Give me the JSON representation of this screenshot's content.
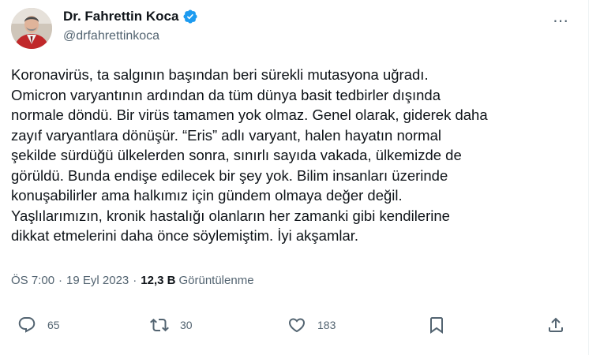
{
  "author": {
    "name": "Dr. Fahrettin Koca",
    "handle": "@drfahrettinkoca",
    "verified": true
  },
  "more_icon": "⋯",
  "tweet": {
    "lines": [
      "Koronavirüs, ta salgının başından beri sürekli mutasyona uğradı.",
      "Omicron varyantının ardından da tüm dünya basit tedbirler dışında",
      "normale döndü. Bir virüs tamamen yok olmaz. Genel olarak, giderek daha",
      "zayıf varyantlara dönüşür. “Eris” adlı varyant, halen hayatın normal",
      "şekilde sürdüğü ülkelerden sonra, sınırlı sayıda vakada, ülkemizde de",
      "görüldü. Bunda endişe edilecek bir şey yok. Bilim insanları üzerinde",
      "konuşabilirler ama halkımız için gündem olmaya değer değil.",
      "Yaşlılarımızın, kronik hastalığı olanların her zamanki gibi kendilerine",
      "dikkat etmelerini daha önce söylemiştim. İyi akşamlar."
    ]
  },
  "meta": {
    "time": "ÖS 7:00",
    "separator": "·",
    "date": "19 Eyl 2023",
    "views_count": "12,3 B",
    "views_label": "Görüntülenme"
  },
  "actions": {
    "replies": "65",
    "retweets": "30",
    "likes": "183"
  },
  "colors": {
    "text": "#0f1419",
    "muted": "#536471",
    "verified": "#1d9bf0"
  }
}
